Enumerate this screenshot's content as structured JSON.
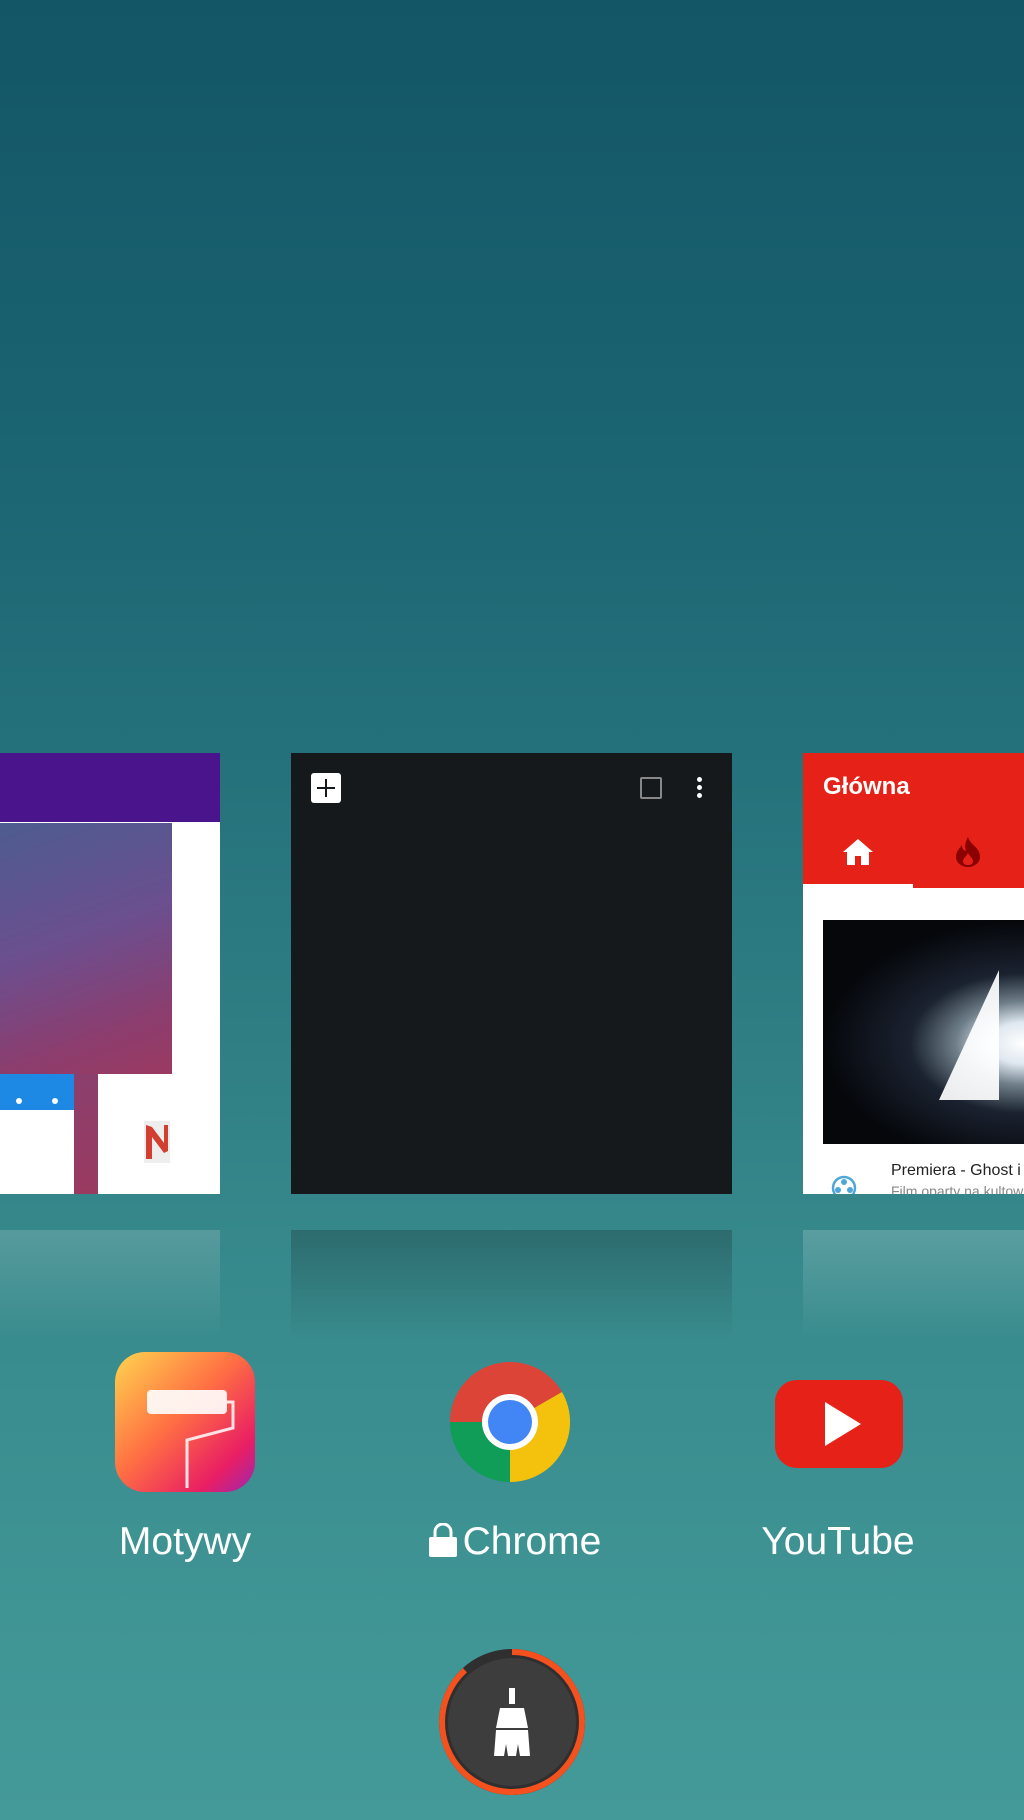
{
  "recents": {
    "cards": [
      {
        "app": "Motywy",
        "type": "themes-preview"
      },
      {
        "app": "Chrome",
        "type": "new-tab",
        "locked": true
      },
      {
        "app": "YouTube",
        "type": "youtube-home",
        "header_title": "Główna",
        "video_title": "Premiera - Ghost i",
        "video_subtitle": "Film oparty na kultow"
      }
    ]
  },
  "apps": [
    {
      "label": "Motywy",
      "icon": "themes-roller-icon",
      "locked": false
    },
    {
      "label": "Chrome",
      "icon": "chrome-icon",
      "locked": true
    },
    {
      "label": "YouTube",
      "icon": "youtube-icon",
      "locked": false
    }
  ],
  "colors": {
    "background_top": "#135666",
    "background_bottom": "#449a99",
    "youtube_red": "#e62117",
    "clean_ring": "#f4511e",
    "chrome_card_bg": "#15191b"
  },
  "clean": {
    "icon": "broom-icon",
    "memory_used_fraction": 0.88
  }
}
